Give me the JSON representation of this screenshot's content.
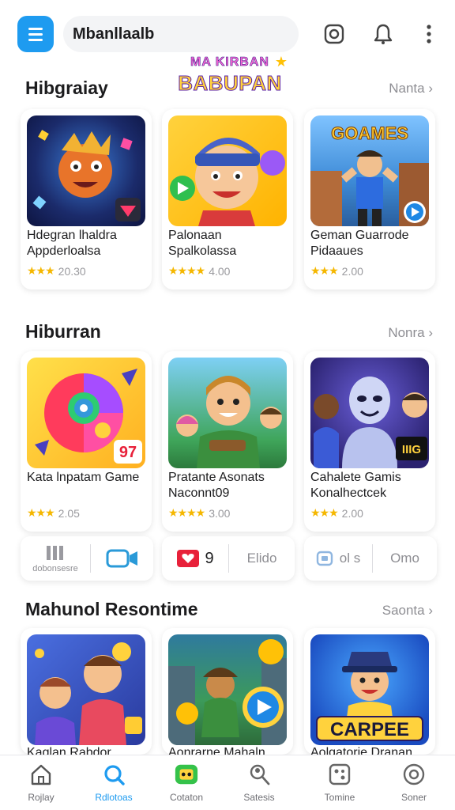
{
  "header": {
    "search_text": "Mbanllaalb",
    "logo_line1": "MA KIRBAN",
    "logo_line2": "BABUPAN",
    "icons": [
      "menu-icon",
      "instagram-icon",
      "bell-icon",
      "more-icon"
    ]
  },
  "sections": [
    {
      "title": "Hibgraiay",
      "see_all": "Nanta ›",
      "cards": [
        {
          "title": "Hdegran lhaldra Appderloalsa",
          "rating": "20.30",
          "stars": "★★★"
        },
        {
          "title": "Palonaan Spalkolassa",
          "rating": "4.00",
          "stars": "★★★★"
        },
        {
          "title": "Geman Guarrode Pidaaues",
          "rating": "2.00",
          "stars": "★★★"
        }
      ]
    },
    {
      "title": "Hiburran",
      "see_all": "Nonra ›",
      "cards": [
        {
          "title": "Kata lnpatam Game",
          "rating": "2.05",
          "stars": "★★★",
          "badge": "97"
        },
        {
          "title": "Pratante Asonats Naconnt09",
          "rating": "3.00",
          "stars": "★★★★"
        },
        {
          "title": "Cahalete Gamis Konalhectcek",
          "rating": "2.00",
          "stars": "★★★",
          "badge": "IIIG"
        }
      ]
    },
    {
      "title": "Mahunol Resontime",
      "see_all": "Saonta ›",
      "cards": [
        {
          "title": "Kaglan Rabdor"
        },
        {
          "title": "Aonrarne Mahaln"
        },
        {
          "title": "Aolgatorie Dranan",
          "banner": "CARPEE"
        }
      ]
    }
  ],
  "toolrow": {
    "cell1_label": "dobonsesre",
    "cell3_label": "9",
    "cell4_label": "Elido",
    "cell5_label": "ol s",
    "cell6_label": "Omo"
  },
  "bottom_nav": [
    {
      "label": "Rojlay",
      "icon": "home-icon"
    },
    {
      "label": "Rdlotoas",
      "icon": "search-icon",
      "active": true
    },
    {
      "label": "Cotaton",
      "icon": "games-icon"
    },
    {
      "label": "Satesis",
      "icon": "profile-search-icon"
    },
    {
      "label": "Tomine",
      "icon": "tournament-icon"
    },
    {
      "label": "Soner",
      "icon": "settings-icon"
    }
  ],
  "colors": {
    "accent": "#1e9bf0",
    "star": "#f5b700",
    "muted": "#8e8e93"
  }
}
